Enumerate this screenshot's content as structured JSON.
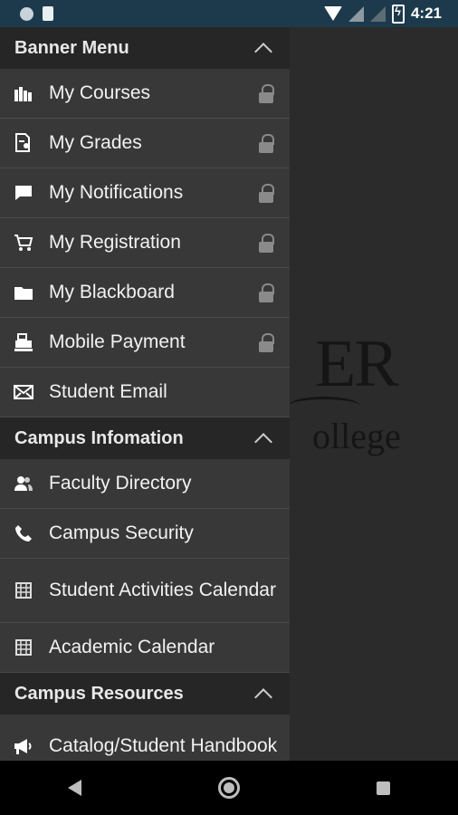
{
  "status_bar": {
    "time": "4:21"
  },
  "background_logo": {
    "letters": "ER",
    "subtitle": "ollege"
  },
  "drawer": {
    "sections": [
      {
        "title": "Banner Menu",
        "items": [
          {
            "label": "My Courses",
            "icon": "books-icon",
            "locked": true
          },
          {
            "label": "My Grades",
            "icon": "grades-icon",
            "locked": true
          },
          {
            "label": "My Notifications",
            "icon": "chat-bubble-icon",
            "locked": true
          },
          {
            "label": "My Registration",
            "icon": "cart-icon",
            "locked": true
          },
          {
            "label": "My Blackboard",
            "icon": "folder-icon",
            "locked": true
          },
          {
            "label": "Mobile Payment",
            "icon": "cash-register-icon",
            "locked": true
          },
          {
            "label": "Student Email",
            "icon": "envelope-icon",
            "locked": false
          }
        ]
      },
      {
        "title": "Campus Infomation",
        "items": [
          {
            "label": "Faculty Directory",
            "icon": "people-icon",
            "locked": false
          },
          {
            "label": "Campus Security",
            "icon": "phone-icon",
            "locked": false
          },
          {
            "label": "Student Activities Calendar",
            "icon": "calendar-icon",
            "locked": false
          },
          {
            "label": "Academic Calendar",
            "icon": "calendar-icon",
            "locked": false
          }
        ]
      },
      {
        "title": "Campus Resources",
        "items": [
          {
            "label": "Catalog/Student Handbook",
            "icon": "megaphone-icon",
            "locked": false
          }
        ]
      }
    ]
  }
}
